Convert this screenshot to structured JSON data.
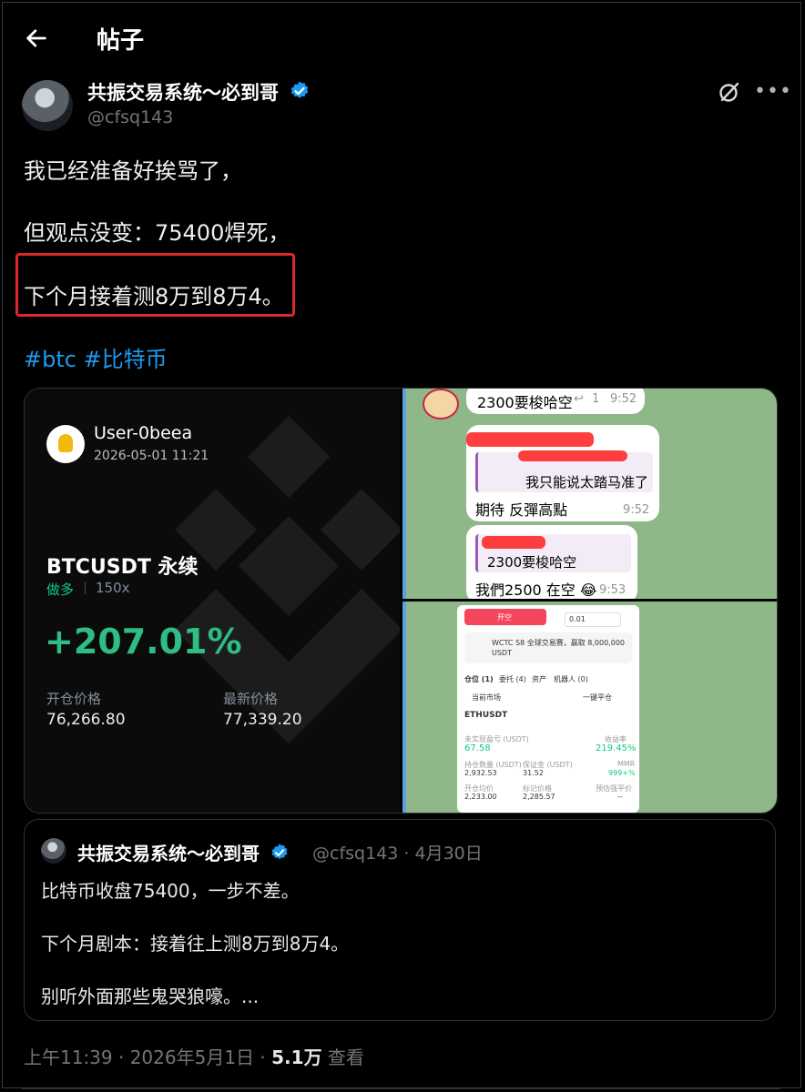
{
  "header": {
    "title": "帖子"
  },
  "author": {
    "name": "共振交易系统～必到哥",
    "handle": "@cfsq143"
  },
  "post": {
    "lines": [
      "我已经准备好挨骂了，",
      "但观点没变：75400焊死，",
      "下个月接着测8万到8万4。"
    ],
    "hashtags": "#btc #比特币"
  },
  "trade_card": {
    "user": "User-0beea",
    "date": "2026-05-01 11:21",
    "pair": "BTCUSDT 永续",
    "side": "做多",
    "leverage": "150x",
    "pnl": "+207.01%",
    "open_label": "开仓价格",
    "open_value": "76,266.80",
    "last_label": "最新价格",
    "last_value": "77,339.20"
  },
  "chat": {
    "msg1": "2300要梭哈空",
    "msg1_time": "9:52",
    "msg1_reply_count": "1",
    "msg2_quote": "我只能说太踏马准了",
    "msg2": "期待 反彈高點",
    "msg2_time": "9:52",
    "msg3_quote": "2300要梭哈空",
    "msg3": "我們2500 在空 😂",
    "msg3_time": "9:53"
  },
  "app": {
    "open_btn": "开空",
    "qty": "0.01",
    "banner": "WCTC S8 全球交易赛，赢取 8,000,000 USDT",
    "tabs": [
      "仓位 (1)",
      "委托 (4)",
      "资产",
      "机器人 (0)"
    ],
    "filter": "当前市场",
    "close_all": "一键平仓",
    "symbol": "ETHUSDT",
    "pnl_label": "未实现盈亏 (USDT)",
    "pnl_value": "67.58",
    "roe_label": "收益率",
    "roe_value": "219.45%",
    "size_label": "持仓数量 (USDT)",
    "size_value": "2,932.53",
    "margin_label": "保证金 (USDT)",
    "margin_value": "31.52",
    "mmr_label": "MMR",
    "mmr_value": "999+%",
    "entry_label": "开仓均价",
    "entry_value": "2,233.00",
    "mark_label": "标记价格",
    "mark_value": "2,285.57",
    "liq_label": "预估强平价",
    "liq_value": "--"
  },
  "quoted": {
    "name": "共振交易系统～必到哥",
    "handle_date": "@cfsq143 · 4月30日",
    "lines": [
      "比特币收盘75400，一步不差。",
      "下个月剧本：接着往上测8万到8万4。",
      "别听外面那些鬼哭狼嚎。..."
    ]
  },
  "meta": {
    "time": "上午11:39 · 2026年5月1日 · ",
    "views": "5.1万",
    "views_label": " 查看"
  },
  "colors": {
    "accent": "#1d9bf0",
    "highlight_box": "#e0252b",
    "profit": "#2ebd85"
  }
}
